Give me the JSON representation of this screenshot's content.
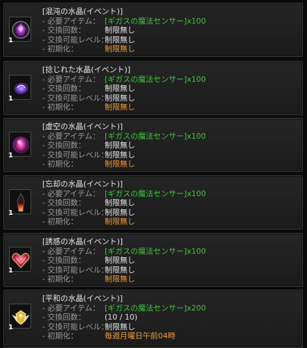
{
  "labels": {
    "required_item": "- 必要アイテム：",
    "exchange_count": "- 交換回数：",
    "exchange_level": "- 交換可能レベル：",
    "reset": "- 初期化："
  },
  "items": [
    {
      "name": "[混沌の水晶(イベント)]",
      "icon": "purple-crystal-icon",
      "quantity": "1",
      "required_item": "[ギガスの魔法センサー]",
      "required_count": "x100",
      "exchange_count": "制限無し",
      "exchange_level": "制限無し",
      "reset": "制限無し"
    },
    {
      "name": "[捻じれた水晶(イベント)]",
      "icon": "twisted-crystal-icon",
      "quantity": "1",
      "required_item": "[ギガスの魔法センサー]",
      "required_count": "x100",
      "exchange_count": "制限無し",
      "exchange_level": "制限無し",
      "reset": "制限無し"
    },
    {
      "name": "[虚空の水晶(イベント)]",
      "icon": "void-crystal-icon",
      "quantity": "1",
      "required_item": "[ギガスの魔法センサー]",
      "required_count": "x100",
      "exchange_count": "制限無し",
      "exchange_level": "制限無し",
      "reset": "制限無し"
    },
    {
      "name": "[忘却の水晶(イベント)]",
      "icon": "oblivion-crystal-icon",
      "quantity": "1",
      "required_item": "[ギガスの魔法センサー]",
      "required_count": "x100",
      "exchange_count": "制限無し",
      "exchange_level": "制限無し",
      "reset": "制限無し"
    },
    {
      "name": "[誘惑の水晶(イベント)]",
      "icon": "heart-crystal-icon",
      "quantity": "1",
      "required_item": "[ギガスの魔法センサー]",
      "required_count": "x100",
      "exchange_count": "制限無し",
      "exchange_level": "制限無し",
      "reset": "制限無し"
    },
    {
      "name": "[平和の水晶(イベント)]",
      "icon": "winged-emblem-icon",
      "quantity": "1",
      "required_item": "[ギガスの魔法センサー]",
      "required_count": "x200",
      "exchange_count": "(10 / 10)",
      "exchange_level": "制限無し",
      "reset": "毎週月曜日午前04時"
    }
  ],
  "colors": {
    "item_link": "#3ec63e",
    "reset_value": "#f29a38",
    "label": "#9a9a9a"
  }
}
